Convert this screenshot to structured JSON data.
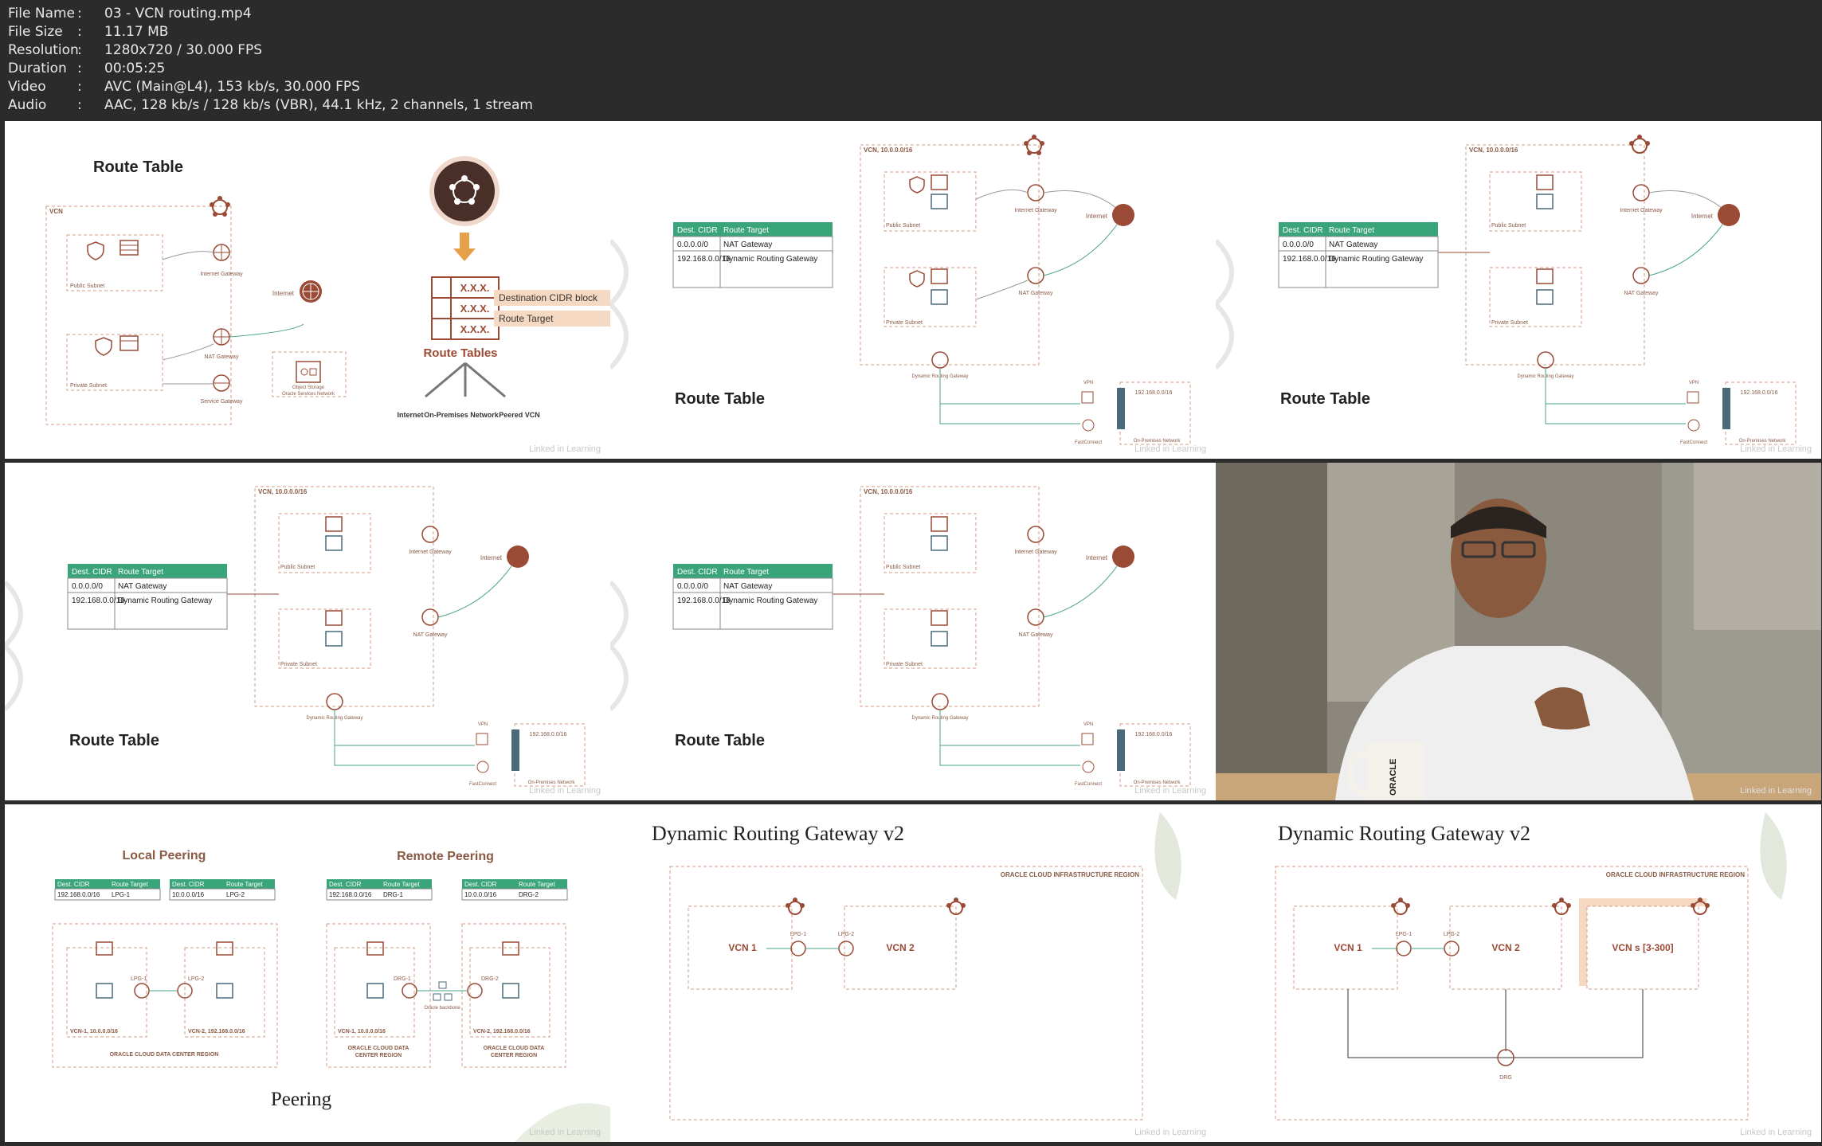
{
  "file_info": {
    "rows": [
      {
        "key": "File Name",
        "value": "03 - VCN routing.mp4"
      },
      {
        "key": "File Size",
        "value": "11.17 MB"
      },
      {
        "key": "Resolution",
        "value": "1280x720 / 30.000 FPS"
      },
      {
        "key": "Duration",
        "value": "00:05:25"
      },
      {
        "key": "Video",
        "value": "AVC (Main@L4), 153 kb/s, 30.000 FPS"
      },
      {
        "key": "Audio",
        "value": "AAC, 128 kb/s / 128 kb/s (VBR), 44.1 kHz, 2 channels, 1 stream"
      }
    ],
    "separator": ":"
  },
  "watermark": "Linked in Learning",
  "slide1": {
    "title": "Route Table",
    "vcn": "VCN",
    "public_subnet": "Public Subnet",
    "private_subnet": "Private Subnet",
    "internet_gateway": "Internet Gateway",
    "nat_gateway": "NAT Gateway",
    "service_gateway": "Service Gateway",
    "internet": "Internet",
    "object_storage": "Object Storage",
    "oracle_services": "Oracle Services Network",
    "xxx": "X.X.X.",
    "dest_cidr_block": "Destination CIDR block",
    "route_target": "Route Target",
    "route_tables": "Route Tables",
    "targets": [
      "Internet",
      "On-Premises Network",
      "Peered VCN"
    ]
  },
  "route_slide": {
    "title": "Route Table",
    "vcn_label": "VCN, 10.0.0.0/16",
    "public_subnet": "Public Subnet",
    "private_subnet": "Private Subnet",
    "internet_gateway": "Internet Gateway",
    "nat_gateway": "NAT Gateway",
    "internet": "Internet",
    "drg": "Dynamic Routing Gateway",
    "vpn": "VPN",
    "fastconnect": "FastConnect",
    "onprem_cidr": "192.168.0.0/16",
    "onprem": "On-Premises Network",
    "table_headers": [
      "Dest. CIDR",
      "Route Target"
    ],
    "table_rows": [
      [
        "0.0.0.0/0",
        "NAT Gateway"
      ],
      [
        "192.168.0.0/16",
        "Dynamic Routing Gateway"
      ]
    ]
  },
  "peering": {
    "title": "Peering",
    "local": "Local Peering",
    "remote": "Remote Peering",
    "headers": [
      "Dest. CIDR",
      "Route Target"
    ],
    "local_tables": [
      [
        "192.168.0.0/16",
        "LPG-1"
      ],
      [
        "10.0.0.0/16",
        "LPG-2"
      ]
    ],
    "remote_tables": [
      [
        "192.168.0.0/16",
        "DRG-1"
      ],
      [
        "10.0.0.0/16",
        "DRG-2"
      ]
    ],
    "lpg1": "LPG-1",
    "lpg2": "LPG-2",
    "drg1": "DRG-1",
    "drg2": "DRG-2",
    "vcn1": "VCN-1, 10.0.0.0/16",
    "vcn2": "VCN-2, 192.168.0.0/16",
    "oracle_backbone": "Oracle backbone",
    "dc_region": "ORACLE CLOUD DATA CENTER REGION",
    "dc_region_split": [
      "ORACLE CLOUD DATA",
      "CENTER REGION"
    ]
  },
  "drg_slide": {
    "title": "Dynamic Routing Gateway v2",
    "region": "ORACLE CLOUD INFRASTRUCTURE REGION",
    "vcn1": "VCN 1",
    "vcn2": "VCN 2",
    "vcns": "VCN s [3-300]",
    "lpg1": "LPG-1",
    "lpg2": "LPG-2",
    "drg": "DRG"
  },
  "video_frame": {
    "mug_text": "ORACLE"
  },
  "colors": {
    "accent": "#9a4a35",
    "table_header": "#3aa57a",
    "brown": "#8a5a45",
    "dashed": "#d59a80"
  }
}
